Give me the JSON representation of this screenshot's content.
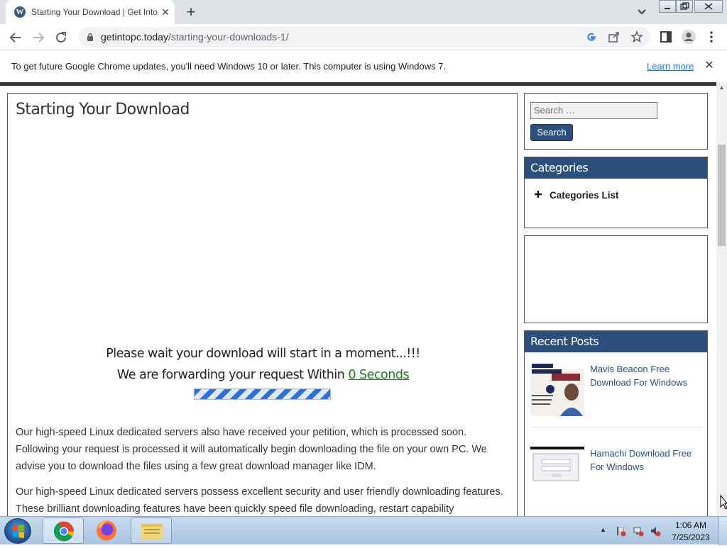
{
  "browser": {
    "tab_title": "Starting Your Download | Get Into PC",
    "tab_close": "✕",
    "new_tab": "+",
    "url_host": "getintopc.today",
    "url_path": "/starting-your-downloads-1/"
  },
  "infobar": {
    "message": "To get future Google Chrome updates, you'll need Windows 10 or later. This computer is using Windows 7.",
    "link": "Learn more",
    "close": "✕"
  },
  "page": {
    "title": "Starting Your Download",
    "wait_line1": "Please wait your download will start in a moment...!!!",
    "wait_line2_prefix": "We are forwarding your request Within ",
    "countdown": "0 Seconds",
    "progress_fraction": 1.0,
    "paragraph1": "Our high-speed Linux dedicated servers also have received your petition, which is processed soon. Following your request is processed it will automatically begin downloading the file on your own PC. We advise you to download the files using a few great download manager like IDM.",
    "paragraph2": "Our high-speed Linux dedicated servers possess excellent security and user friendly downloading features. These brilliant downloading features have been quickly speed file downloading, restart capability"
  },
  "sidebar": {
    "search_placeholder": "Search …",
    "search_button": "Search",
    "categories_heading": "Categories",
    "categories_item": "Categories List",
    "recent_heading": "Recent Posts",
    "recent_posts": [
      {
        "title": "Mavis Beacon Free Download For Windows"
      },
      {
        "title": "Hamachi Download Free For Windows"
      }
    ]
  },
  "taskbar": {
    "time": "1:06 AM",
    "date": "7/25/2023"
  },
  "colors": {
    "accent": "#2c4f7c",
    "countdown": "#1e7b1e",
    "link": "#1a73e8"
  }
}
